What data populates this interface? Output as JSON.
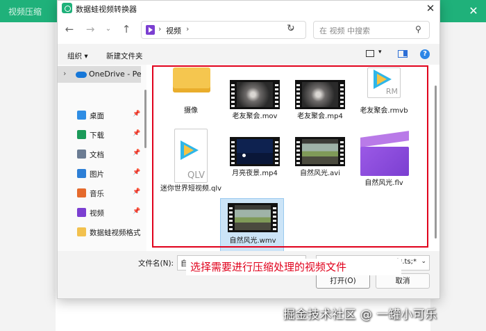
{
  "background_app": {
    "title": "视频压缩"
  },
  "dialog": {
    "title": "数据蛙视频转换器",
    "address": {
      "location": "视频",
      "separator": "›"
    },
    "search_placeholder": "在 视频 中搜索",
    "toolbar": {
      "organize": "组织 ▾",
      "new_folder": "新建文件夹"
    },
    "sidebar": {
      "onedrive": "OneDrive - Per",
      "items": [
        {
          "label": "桌面",
          "icon": "desktop-icon",
          "color": "#2f8de4",
          "pinned": true
        },
        {
          "label": "下载",
          "icon": "download-icon",
          "color": "#1b9a59",
          "pinned": true
        },
        {
          "label": "文档",
          "icon": "document-icon",
          "color": "#6b7c93",
          "pinned": true
        },
        {
          "label": "图片",
          "icon": "picture-icon",
          "color": "#2d7fd6",
          "pinned": true
        },
        {
          "label": "音乐",
          "icon": "music-icon",
          "color": "#e56a2c",
          "pinned": true
        },
        {
          "label": "视频",
          "icon": "video-icon",
          "color": "#7b3fd1",
          "pinned": true
        },
        {
          "label": "数据蛙视频格式",
          "icon": "folder-icon",
          "color": "#f2c14e",
          "pinned": false
        }
      ]
    },
    "files": [
      {
        "name": "摄像",
        "kind": "folder"
      },
      {
        "name": "老友聚会.mov",
        "kind": "video-night"
      },
      {
        "name": "老友聚会.mp4",
        "kind": "video-night"
      },
      {
        "name": "老友聚会.rmvb",
        "kind": "qq-player",
        "badge": "RM"
      },
      {
        "name": "迷你世界短视频.qlv",
        "kind": "qq-player",
        "badge": "QLV"
      },
      {
        "name": "月亮夜景.mp4",
        "kind": "video-moon"
      },
      {
        "name": "自然风光.avi",
        "kind": "video-nature"
      },
      {
        "name": "自然风光.flv",
        "kind": "clapper"
      },
      {
        "name": "自然风光.wmv",
        "kind": "video-nature",
        "selected": true
      }
    ],
    "filename_label": "文件名(N):",
    "filename_value": "自然",
    "filetype_value": "s (*.ts;*",
    "open_button": "打开(O)",
    "cancel_button": "取消"
  },
  "annotation": "选择需要进行压缩处理的视频文件",
  "watermark": "掘金技术社区 @ 一罐小可乐",
  "colors": {
    "accent_green": "#1fb17a",
    "highlight_red": "#e0001b",
    "selection_blue": "#cce4f7"
  }
}
